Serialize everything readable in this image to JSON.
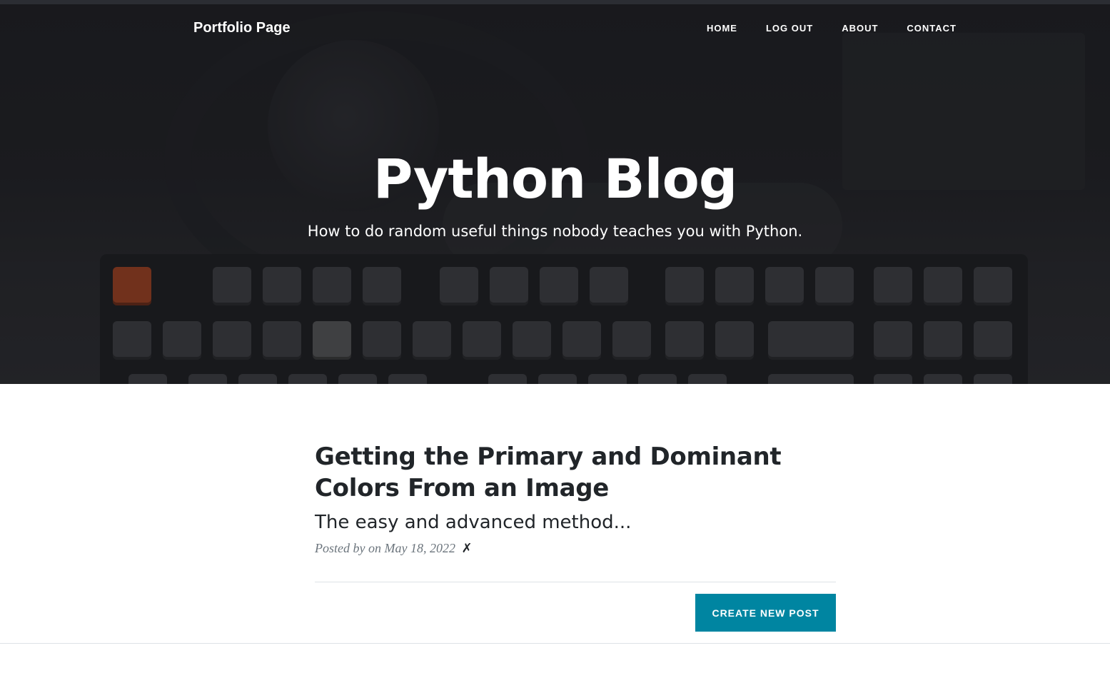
{
  "navbar": {
    "brand": "Portfolio Page",
    "links": [
      "HOME",
      "LOG OUT",
      "ABOUT",
      "CONTACT"
    ]
  },
  "header": {
    "title": "Python Blog",
    "subtitle": "How to do random useful things nobody teaches you with Python."
  },
  "posts": [
    {
      "title": "Getting the Primary and Dominant Colors From an Image",
      "subtitle": "The easy and advanced method...",
      "meta": "Posted by on May 18, 2022",
      "delete_glyph": "✗"
    }
  ],
  "actions": {
    "create_post_label": "CREATE NEW POST"
  },
  "colors": {
    "accent": "#0085a1",
    "heading_text": "#212529",
    "meta_text": "#6c757d"
  }
}
